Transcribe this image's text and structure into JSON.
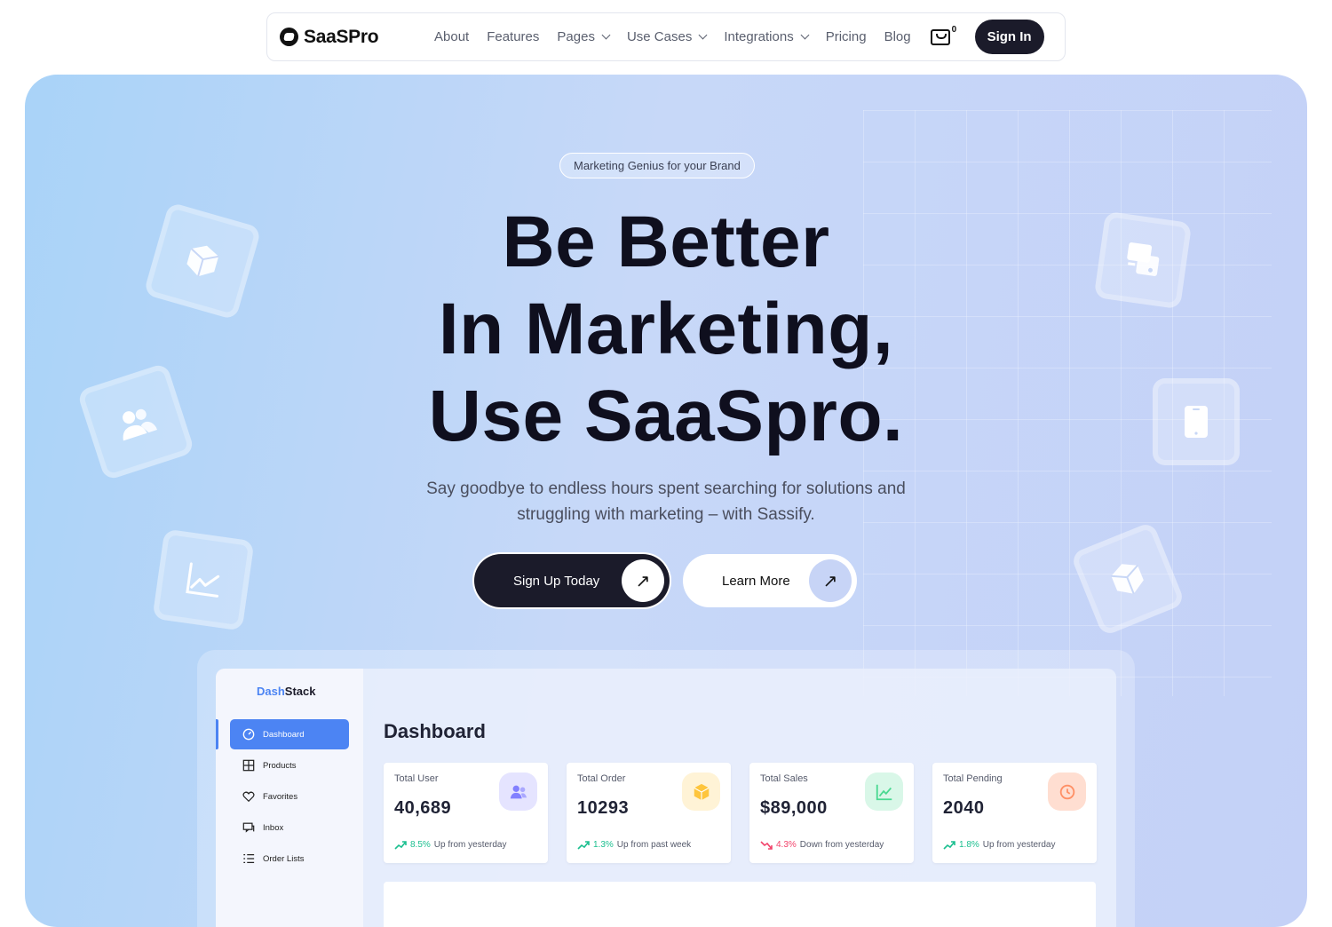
{
  "nav": {
    "brand": "SaaSPro",
    "items": [
      {
        "label": "About",
        "dropdown": false
      },
      {
        "label": "Features",
        "dropdown": false
      },
      {
        "label": "Pages",
        "dropdown": true
      },
      {
        "label": "Use Cases",
        "dropdown": true
      },
      {
        "label": "Integrations",
        "dropdown": true
      },
      {
        "label": "Pricing",
        "dropdown": false
      },
      {
        "label": "Blog",
        "dropdown": false
      }
    ],
    "cart_count": "0",
    "signin_label": "Sign In"
  },
  "hero": {
    "badge": "Marketing Genius for your Brand",
    "headline": [
      "Be Better",
      "In Marketing,",
      "Use SaaSpro."
    ],
    "subtitle_line1": "Say goodbye to endless hours spent searching for solutions and",
    "subtitle_line2": "struggling with marketing – with Sassify.",
    "primary_cta": "Sign Up Today",
    "secondary_cta": "Learn More",
    "arrow_icon": "arrow-up-right-icon",
    "floating_icons": [
      "cube-icon",
      "users-icon",
      "chart-line-icon",
      "chat-icon",
      "tablet-icon",
      "cube-icon"
    ]
  },
  "dashboard": {
    "brand_prefix": "Dash",
    "brand_suffix": "Stack",
    "sidebar": [
      {
        "label": "Dashboard",
        "icon": "gauge-icon",
        "active": true
      },
      {
        "label": "Products",
        "icon": "grid-icon",
        "active": false
      },
      {
        "label": "Favorites",
        "icon": "heart-icon",
        "active": false
      },
      {
        "label": "Inbox",
        "icon": "inbox-icon",
        "active": false
      },
      {
        "label": "Order Lists",
        "icon": "list-icon",
        "active": false
      }
    ],
    "title": "Dashboard",
    "cards": [
      {
        "title": "Total User",
        "value": "40,689",
        "pct": "8.5%",
        "note": "Up from yesterday",
        "direction": "up",
        "icon": "users-icon",
        "icon_color": "#8280ff",
        "icon_bg": "#e5e4ff"
      },
      {
        "title": "Total Order",
        "value": "10293",
        "pct": "1.3%",
        "note": "Up from past week",
        "direction": "up",
        "icon": "box-icon",
        "icon_color": "#fec53d",
        "icon_bg": "#fff3d6"
      },
      {
        "title": "Total Sales",
        "value": "$89,000",
        "pct": "4.3%",
        "note": "Down from yesterday",
        "direction": "down",
        "icon": "chart-line-icon",
        "icon_color": "#4ad991",
        "icon_bg": "#d9f7e8"
      },
      {
        "title": "Total Pending",
        "value": "2040",
        "pct": "1.8%",
        "note": "Up from yesterday",
        "direction": "up",
        "icon": "history-icon",
        "icon_color": "#ff9066",
        "icon_bg": "#ffded1"
      }
    ]
  },
  "colors": {
    "accent_dark": "#1b1b2a",
    "dashboard_blue": "#4c84f3",
    "up": "#1bbf8f",
    "down": "#f2436b"
  }
}
